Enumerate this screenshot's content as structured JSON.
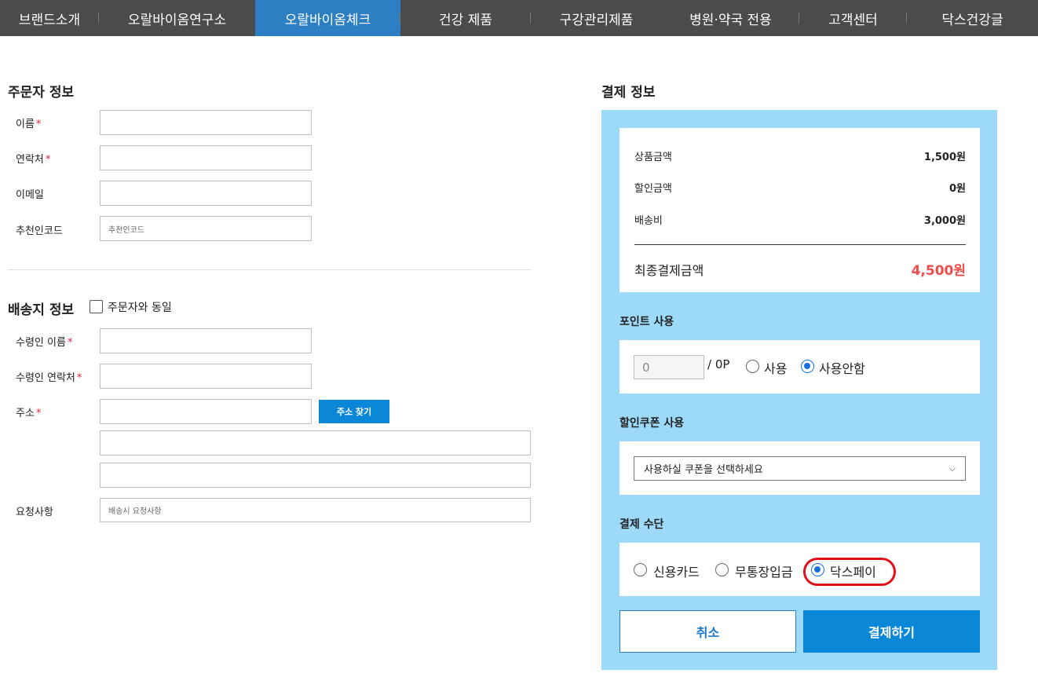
{
  "nav": {
    "items": [
      {
        "label": "브랜드소개"
      },
      {
        "label": "오랄바이옴연구소"
      },
      {
        "label": "오랄바이옴체크"
      },
      {
        "label": "건강 제품"
      },
      {
        "label": "구강관리제품"
      },
      {
        "label": "병원·약국 전용"
      },
      {
        "label": "고객센터"
      },
      {
        "label": "닥스건강글"
      }
    ],
    "active_index": 2,
    "bg_color": "#4b4b4b",
    "active_color": "#2d7fc4"
  },
  "orderer": {
    "title": "주문자 정보",
    "fields": [
      {
        "label": "이름",
        "required": "*",
        "value": ""
      },
      {
        "label": "연락처",
        "required": "*",
        "value": ""
      },
      {
        "label": "이메일",
        "required": "",
        "value": ""
      },
      {
        "label": "추천인코드",
        "required": "",
        "placeholder": "추천인코드"
      }
    ]
  },
  "shipping": {
    "title": "배송지 정보",
    "same_as_orderer": "주문자와 동일",
    "fields": {
      "recipient_name": {
        "label": "수령인 이름",
        "required": "*"
      },
      "recipient_phone": {
        "label": "수령인 연락처",
        "required": "*"
      },
      "address": {
        "label": "주소",
        "required": "*"
      },
      "request": {
        "label": "요청사항",
        "placeholder": "배송시 요청사항"
      }
    },
    "address_button": "주소 찾기"
  },
  "payment": {
    "title": "결제 정보",
    "summary": {
      "product_label": "상품금액",
      "product_value": "1,500원",
      "discount_label": "할인금액",
      "discount_value": "0원",
      "shipping_label": "배송비",
      "shipping_value": "3,000원",
      "total_label": "최종결제금액",
      "total_value": "4,500원"
    },
    "points": {
      "title": "포인트 사용",
      "input_value": "0",
      "unit": "/ 0P",
      "use_label": "사용",
      "no_use_label": "사용안함",
      "selected": "사용안함"
    },
    "coupon": {
      "title": "할인쿠폰 사용",
      "selected": "사용하실 쿠폰을 선택하세요"
    },
    "method": {
      "title": "결제 수단",
      "options": [
        "신용카드",
        "무통장입금",
        "닥스페이"
      ],
      "selected": "닥스페이"
    },
    "cancel_button": "취소",
    "pay_button": "결제하기",
    "panel_color": "#9ddaf9",
    "total_color": "#f04a4a",
    "highlight_color": "#e0101a"
  }
}
